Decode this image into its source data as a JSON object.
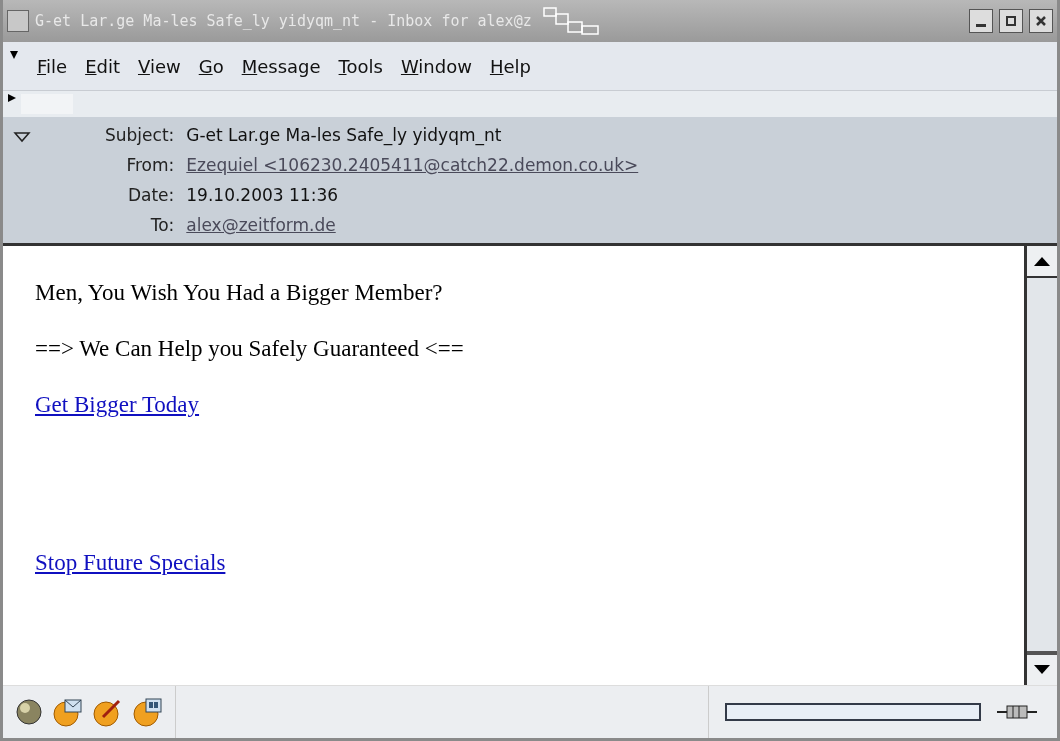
{
  "window": {
    "title": "G-et Lar.ge Ma-les Safe_ly yidyqm_nt - Inbox for alex@z"
  },
  "menu": [
    "File",
    "Edit",
    "View",
    "Go",
    "Message",
    "Tools",
    "Window",
    "Help"
  ],
  "header": {
    "expanded": true,
    "fields": [
      {
        "label": "Subject:",
        "value": "G-et Lar.ge Ma-les Safe_ly yidyqm_nt",
        "kind": "text"
      },
      {
        "label": "From:",
        "value": "Ezequiel <106230.2405411@catch22.demon.co.uk>",
        "kind": "link"
      },
      {
        "label": "Date:",
        "value": "19.10.2003 11:36",
        "kind": "text"
      },
      {
        "label": "To:",
        "value": "alex@zeitform.de",
        "kind": "link"
      }
    ]
  },
  "body": [
    {
      "kind": "text",
      "text": "Men, You Wish You Had a Bigger Member?"
    },
    {
      "kind": "text",
      "text": "==> We Can Help you Safely Guaranteed <=="
    },
    {
      "kind": "link",
      "text": "Get Bigger Today"
    },
    {
      "kind": "spacer"
    },
    {
      "kind": "link",
      "text": "Stop Future Specials"
    }
  ],
  "status_bar": {
    "progress": {
      "level": 0
    }
  }
}
